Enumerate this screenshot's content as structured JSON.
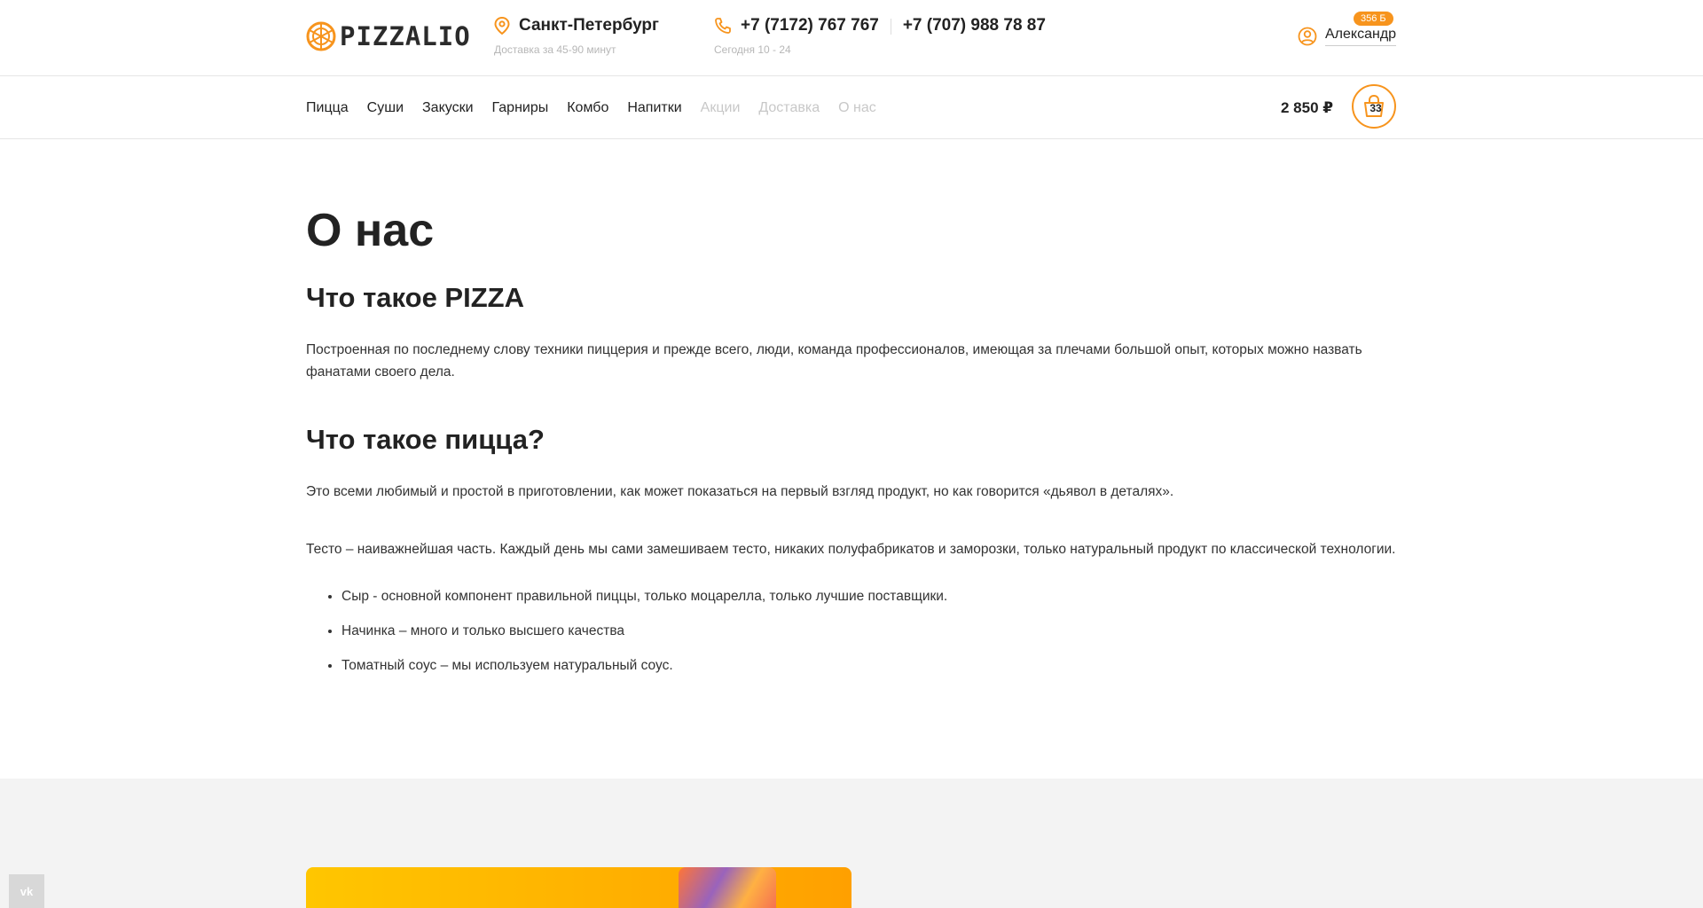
{
  "header": {
    "logo_text": "PIZZALIO",
    "city": "Санкт-Петербург",
    "delivery_time": "Доставка за 45-90 минут",
    "phone_1": "+7 (7172) 767 767",
    "phone_2": "+7 (707) 988 78 87",
    "hours": "Сегодня 10 - 24",
    "user_name": "Александр",
    "bonus_badge": "356 Б",
    "accent_color": "#f7941d"
  },
  "nav": {
    "items": [
      {
        "label": "Пицца"
      },
      {
        "label": "Суши"
      },
      {
        "label": "Закуски"
      },
      {
        "label": "Гарниры"
      },
      {
        "label": "Комбо"
      },
      {
        "label": "Напитки"
      },
      {
        "label": "Акции"
      },
      {
        "label": "Доставка"
      },
      {
        "label": "О нас"
      }
    ],
    "cart_total": "2 850 ₽",
    "cart_count": "33"
  },
  "content": {
    "title": "О нас",
    "h2_1": "Что такое PIZZA",
    "p1": "Построенная по последнему слову техники пиццерия и прежде всего, люди, команда профессионалов, имеющая за плечами большой опыт, которых можно назвать фанатами своего дела.",
    "h2_2": "Что такое пицца?",
    "p2": "Это всеми любимый и простой в приготовлении, как может показаться на первый взгляд продукт, но как говорится «дьявол в деталях».",
    "p3": "Тесто – наиважнейшая часть. Каждый день мы сами замешиваем тесто, никаких полуфабрикатов и заморозки, только натуральный продукт по классической технологии.",
    "list": [
      "Сыр - основной компонент правильной пиццы, только моцарелла, только лучшие поставщики.",
      "Начинка – много и только высшего качества",
      "Томатный соус – мы используем натуральный соус."
    ]
  },
  "footer": {
    "vk_label": "vk"
  }
}
